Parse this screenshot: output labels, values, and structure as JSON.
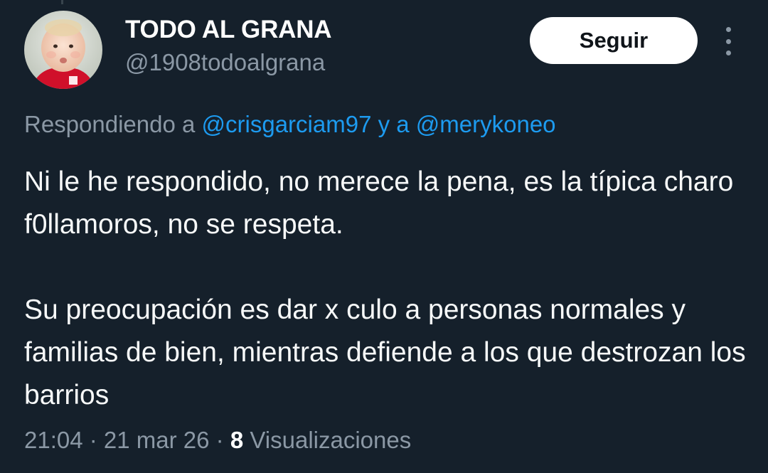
{
  "author": {
    "display_name": "TODO AL GRANA",
    "handle": "@1908todoalgrana"
  },
  "actions": {
    "follow_label": "Seguir"
  },
  "reply_context": {
    "prefix": "Respondiendo a ",
    "mention_1": "@crisgarciam97",
    "conjunction": " y a ",
    "mention_2": "@merykoneo"
  },
  "tweet": {
    "paragraph_1": "Ni le he respondido, no merece la pena, es la típica charo f0llamoros, no se respeta.",
    "paragraph_2": "Su preocupación es dar x culo a personas normales y familias de bien, mientras defiende a los que destrozan los barrios"
  },
  "meta": {
    "time": "21:04",
    "separator": " · ",
    "date": "21 mar 26",
    "views_count": "8",
    "views_label": " Visualizaciones"
  },
  "colors": {
    "background": "#15202b",
    "mention": "#1d9bf0",
    "secondary_text": "#8b98a5"
  },
  "icons": {
    "more": "more-vertical-icon"
  }
}
